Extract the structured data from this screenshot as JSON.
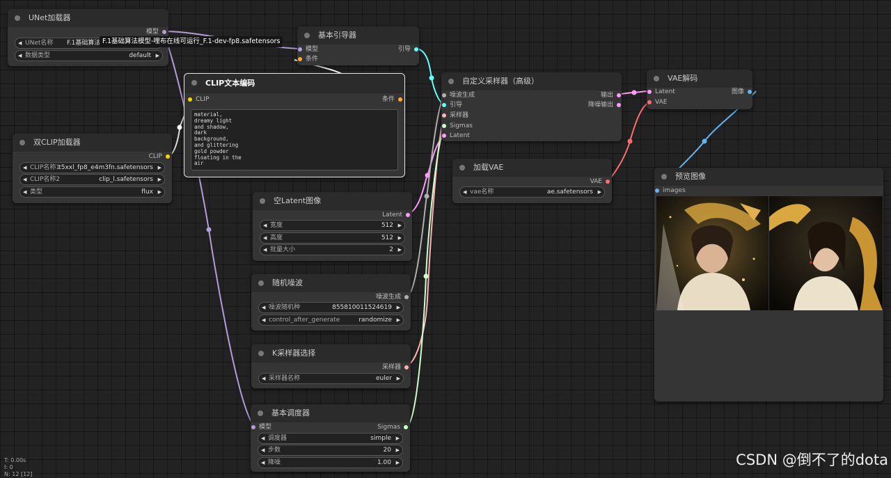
{
  "nodes": {
    "unet_loader": {
      "title": "UNet加载器",
      "output": "模型",
      "unet_name_label": "UNet名称",
      "unet_name_value": "F.1基础算法模型",
      "dtype_label": "数据类型",
      "dtype_value": "default"
    },
    "tooltip": "F.1基础算法模型-哩布在线可运行_F.1-dev-fp8.safetensors",
    "basic_guider": {
      "title": "基本引导器",
      "input_model": "模型",
      "input_cond": "条件",
      "output": "引导"
    },
    "clip_text_encode": {
      "title": "CLIP文本编码",
      "input": "CLIP",
      "output": "条件",
      "text": "material,\ndreamy light\nand shadow,\ndark\nbackground,\nand glittering\ngold powder\nfloating in the\nair"
    },
    "dual_clip": {
      "title": "双CLIP加载器",
      "output": "CLIP",
      "clip1_label": "CLIP名称1",
      "clip1_value": "t5xxl_fp8_e4m3fn.safetensors",
      "clip2_label": "CLIP名称2",
      "clip2_value": "clip_l.safetensors",
      "type_label": "类型",
      "type_value": "flux"
    },
    "custom_sampler": {
      "title": "自定义采样器（高级）",
      "in_noise": "噪波生成",
      "in_guider": "引导",
      "in_sampler": "采样器",
      "in_sigmas": "Sigmas",
      "in_latent": "Latent",
      "out_output": "输出",
      "out_denoised": "降噪输出"
    },
    "vae_decode": {
      "title": "VAE解码",
      "in_latent": "Latent",
      "in_vae": "VAE",
      "output": "图像"
    },
    "load_vae": {
      "title": "加载VAE",
      "output": "VAE",
      "vae_label": "vae名称",
      "vae_value": "ae.safetensors"
    },
    "preview": {
      "title": "预览图像",
      "input": "images"
    },
    "empty_latent": {
      "title": "空Latent图像",
      "output": "Latent",
      "width_label": "宽度",
      "width_value": "512",
      "height_label": "高度",
      "height_value": "512",
      "batch_label": "批量大小",
      "batch_value": "2"
    },
    "random_noise": {
      "title": "随机噪波",
      "output": "噪波生成",
      "seed_label": "噪波随机种",
      "seed_value": "855810011524619",
      "control_label": "control_after_generate",
      "control_value": "randomize"
    },
    "ksampler_select": {
      "title": "K采样器选择",
      "output": "采样器",
      "sampler_label": "采样器名称",
      "sampler_value": "euler"
    },
    "basic_scheduler": {
      "title": "基本调度器",
      "input": "模型",
      "output": "Sigmas",
      "scheduler_label": "调度器",
      "scheduler_value": "simple",
      "steps_label": "步数",
      "steps_value": "20",
      "denoise_label": "降噪",
      "denoise_value": "1.00"
    }
  },
  "stats": {
    "time": "T: 0.00s",
    "i": "I: 0",
    "n": "N: 12 [12]"
  },
  "watermark": "CSDN @倒不了的dota",
  "colors": {
    "model": "#b39ddb",
    "clip": "#ffd500",
    "conditioning": "#ffa931",
    "guider": "#66ffff",
    "latent": "#ff9cf9",
    "vae": "#ff6e6e",
    "image": "#64b5f6",
    "sigmas": "#cdffcd",
    "sampler": "#ffb3b3",
    "noise": "#b0b0b0"
  }
}
